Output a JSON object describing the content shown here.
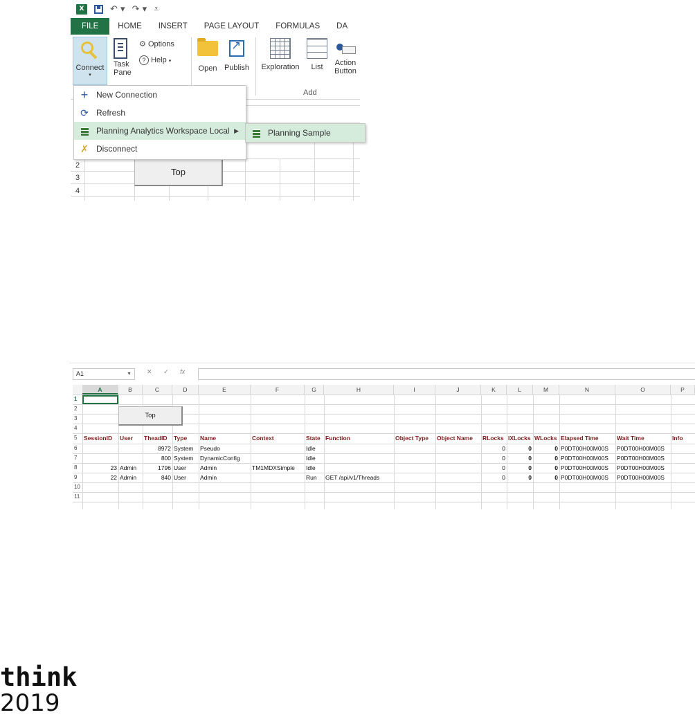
{
  "ribbon": {
    "tabs": [
      "FILE",
      "HOME",
      "INSERT",
      "PAGE LAYOUT",
      "FORMULAS",
      "DA"
    ],
    "buttons": {
      "connect": "Connect",
      "task_pane_1": "Task",
      "task_pane_2": "Pane",
      "options": "Options",
      "help": "Help",
      "open": "Open",
      "publish": "Publish",
      "exploration": "Exploration",
      "list": "List",
      "action_1": "Action",
      "action_2": "Button"
    },
    "group_add": "Add",
    "connect_menu": {
      "new_connection": "New Connection",
      "refresh": "Refresh",
      "pa_workspace_local": "Planning Analytics Workspace Local",
      "disconnect": "Disconnect",
      "submenu_planning_sample": "Planning Sample"
    },
    "sheet_rows": [
      "2",
      "3",
      "4"
    ],
    "top_button": "Top"
  },
  "sheet": {
    "name_box": "A1",
    "column_headers": [
      "A",
      "B",
      "C",
      "D",
      "E",
      "F",
      "G",
      "H",
      "I",
      "J",
      "K",
      "L",
      "M",
      "N",
      "O",
      "P"
    ],
    "row_numbers": [
      "1",
      "2",
      "3",
      "4",
      "5",
      "6",
      "7",
      "8",
      "9",
      "10",
      "11"
    ],
    "top_button": "Top",
    "table_headers": [
      "SessionID",
      "User",
      "TheadID",
      "Type",
      "Name",
      "Context",
      "State",
      "Function",
      "Object Type",
      "Object Name",
      "RLocks",
      "IXLocks",
      "WLocks",
      "Elapsed Time",
      "Wait Time",
      "Info"
    ],
    "rows": [
      [
        "",
        "",
        "8972",
        "System",
        "Pseudo",
        "",
        "Idle",
        "",
        "",
        "",
        "0",
        "0",
        "0",
        "P0DT00H00M00S",
        "P0DT00H00M00S",
        ""
      ],
      [
        "",
        "",
        "800",
        "System",
        "DynamicConfig",
        "",
        "Idle",
        "",
        "",
        "",
        "0",
        "0",
        "0",
        "P0DT00H00M00S",
        "P0DT00H00M00S",
        ""
      ],
      [
        "23",
        "Admin",
        "1796",
        "User",
        "Admin",
        "TM1MDXSimple",
        "Idle",
        "",
        "",
        "",
        "0",
        "0",
        "0",
        "P0DT00H00M00S",
        "P0DT00H00M00S",
        ""
      ],
      [
        "22",
        "Admin",
        "840",
        "User",
        "Admin",
        "",
        "Run",
        "GET /api/v1/Threads",
        "",
        "",
        "0",
        "0",
        "0",
        "P0DT00H00M00S",
        "P0DT00H00M00S",
        ""
      ]
    ]
  },
  "branding": {
    "line1": "think",
    "line2": "2019"
  },
  "colors": {
    "excel_green": "#217346",
    "header_text": "#7a1d1d",
    "menu_hover": "#d5ecdc"
  }
}
